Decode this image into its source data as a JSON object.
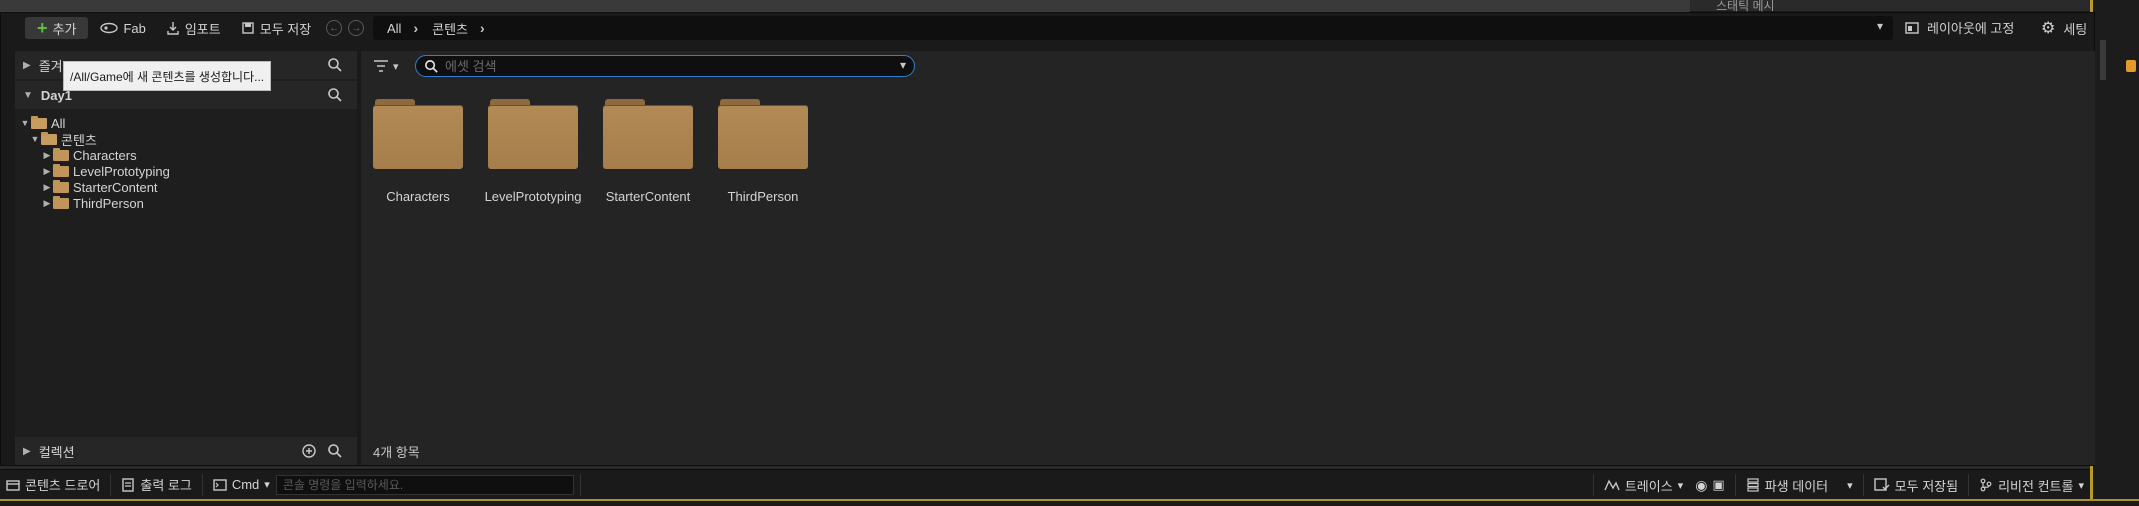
{
  "toolbar": {
    "add_label": "추가",
    "fab_label": "Fab",
    "import_label": "임포트",
    "save_all_label": "모두 저장",
    "lock_layout_label": "레이아웃에 고정",
    "settings_label": "세팅"
  },
  "breadcrumb": [
    "All",
    "콘텐츠"
  ],
  "tooltip": "/All/Game에 새 콘텐츠를 생성합니다...",
  "sources": {
    "favorites_label": "즐겨",
    "project_label": "Day1",
    "collections_label": "컬렉션",
    "tree": [
      {
        "label": "All",
        "depth": 0,
        "expanded": true
      },
      {
        "label": "콘텐츠",
        "depth": 1,
        "expanded": true
      },
      {
        "label": "Characters",
        "depth": 2,
        "expanded": false
      },
      {
        "label": "LevelPrototyping",
        "depth": 2,
        "expanded": false
      },
      {
        "label": "StarterContent",
        "depth": 2,
        "expanded": false
      },
      {
        "label": "ThirdPerson",
        "depth": 2,
        "expanded": false
      }
    ]
  },
  "search": {
    "placeholder": "에셋 검색",
    "value": ""
  },
  "assets": [
    {
      "name": "Characters"
    },
    {
      "name": "LevelPrototyping"
    },
    {
      "name": "StarterContent"
    },
    {
      "name": "ThirdPerson"
    }
  ],
  "item_count": "4개 항목",
  "status_bar": {
    "content_drawer": "콘텐츠 드로어",
    "output_log": "출력 로그",
    "cmd_label": "Cmd",
    "cmd_placeholder": "콘솔 명령을 입력하세요.",
    "trace": "트레이스",
    "derived_data": "파생 데이터",
    "all_saved": "모두 저장됨",
    "revision_control": "리비전 컨트롤"
  },
  "background": {
    "details_panel_title": "스태틱 메시"
  },
  "colors": {
    "accent_focus": "#2f7fd1",
    "folder": "#b18a55",
    "add_plus": "#5fbf3f"
  }
}
